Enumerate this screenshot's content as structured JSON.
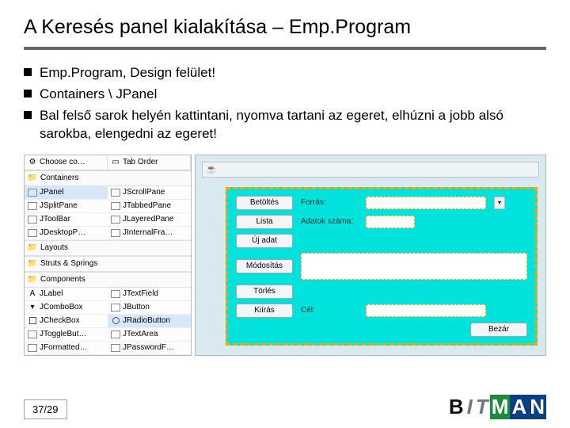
{
  "title": "A Keresés panel kialakítása – Emp.Program",
  "bullets": [
    "Emp.Program, Design felület!",
    "Containers \\ JPanel",
    "Bal felső sarok helyén kattintani, nyomva tartani az egeret, elhúzni a jobb alsó sarokba, elengedni az egeret!"
  ],
  "palette": {
    "head": [
      "Choose co…",
      "Tab Order"
    ],
    "groups": [
      {
        "name": "Containers",
        "items": [
          "JPanel",
          "JScrollPane",
          "JSplitPane",
          "JTabbedPane",
          "JToolBar",
          "JLayeredPane",
          "JDesktopP…",
          "JInternalFra…"
        ]
      },
      {
        "name": "Layouts",
        "items": []
      },
      {
        "name": "Struts & Springs",
        "items": []
      },
      {
        "name": "Components",
        "items": [
          "JLabel",
          "JTextField",
          "JComboBox",
          "JButton",
          "JCheckBox",
          "JRadioButton",
          "JToggleBut…",
          "JTextArea",
          "JFormatted…",
          "JPasswordF…"
        ]
      }
    ]
  },
  "canvas": {
    "rows": [
      {
        "btn": "Betöltés",
        "label": "Forrás:",
        "field": true,
        "select": true
      },
      {
        "btn": "Lista",
        "label": "Adatok száma:",
        "field": true
      },
      {
        "btn": "Új adat"
      },
      {
        "btn": "Módosítás",
        "wide": true
      },
      {
        "btn": "Törlés"
      },
      {
        "btn": "Kiírás",
        "label": "Cél:",
        "field": true
      }
    ],
    "closeBtn": "Bezár"
  },
  "page": "37/29",
  "logo": [
    "B",
    "I",
    "T",
    "M",
    "A",
    "N"
  ]
}
